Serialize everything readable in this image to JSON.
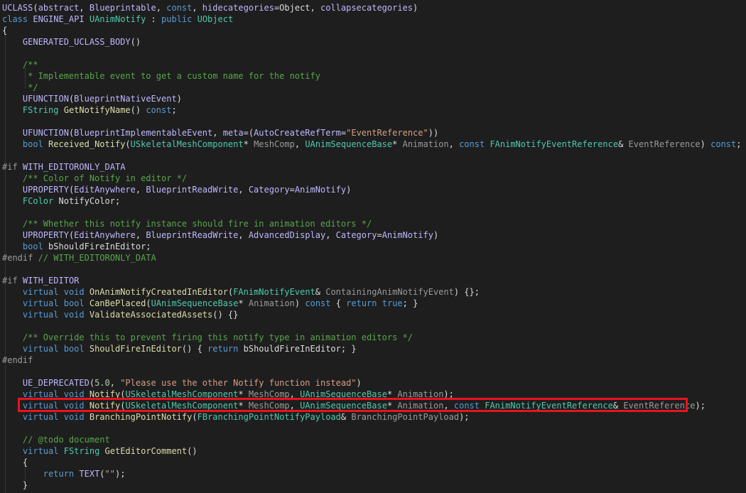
{
  "editor": {
    "language": "cpp",
    "theme_colors": {
      "background": "#1e1e1e",
      "highlight_box": "#e8141c"
    },
    "highlighted_line": 35,
    "lines": [
      [
        [
          "mc",
          "UCLASS"
        ],
        [
          "tx",
          "("
        ],
        [
          "mc",
          "abstract"
        ],
        [
          "tx",
          ", "
        ],
        [
          "mc",
          "Blueprintable"
        ],
        [
          "tx",
          ", "
        ],
        [
          "kw",
          "const"
        ],
        [
          "tx",
          ", "
        ],
        [
          "mc",
          "hidecategories"
        ],
        [
          "tx",
          "=Object, "
        ],
        [
          "mc",
          "collapsecategories"
        ],
        [
          "tx",
          ")"
        ]
      ],
      [
        [
          "kw",
          "class"
        ],
        [
          "tx",
          " "
        ],
        [
          "mc",
          "ENGINE_API"
        ],
        [
          "tx",
          " "
        ],
        [
          "ty",
          "UAnimNotify"
        ],
        [
          "tx",
          " : "
        ],
        [
          "kw",
          "public"
        ],
        [
          "tx",
          " "
        ],
        [
          "ty",
          "UObject"
        ]
      ],
      [
        [
          "tx",
          "{"
        ]
      ],
      [
        [
          "tx",
          "    "
        ],
        [
          "mc",
          "GENERATED_UCLASS_BODY"
        ],
        [
          "tx",
          "()"
        ]
      ],
      [
        [
          "tx",
          ""
        ]
      ],
      [
        [
          "tx",
          "    "
        ],
        [
          "cm",
          "/**"
        ]
      ],
      [
        [
          "tx",
          "    "
        ],
        [
          "cm",
          " * Implementable event to get a custom name for the notify"
        ]
      ],
      [
        [
          "tx",
          "    "
        ],
        [
          "cm",
          " */"
        ]
      ],
      [
        [
          "tx",
          "    "
        ],
        [
          "mc",
          "UFUNCTION"
        ],
        [
          "tx",
          "("
        ],
        [
          "mc",
          "BlueprintNativeEvent"
        ],
        [
          "tx",
          ")"
        ]
      ],
      [
        [
          "tx",
          "    "
        ],
        [
          "ty",
          "FString"
        ],
        [
          "tx",
          " "
        ],
        [
          "fn",
          "GetNotifyName"
        ],
        [
          "tx",
          "() "
        ],
        [
          "kw",
          "const"
        ],
        [
          "tx",
          ";"
        ]
      ],
      [
        [
          "tx",
          ""
        ]
      ],
      [
        [
          "tx",
          "    "
        ],
        [
          "mc",
          "UFUNCTION"
        ],
        [
          "tx",
          "("
        ],
        [
          "mc",
          "BlueprintImplementableEvent"
        ],
        [
          "tx",
          ", "
        ],
        [
          "mc",
          "meta"
        ],
        [
          "tx",
          "=("
        ],
        [
          "mc",
          "AutoCreateRefTerm"
        ],
        [
          "tx",
          "="
        ],
        [
          "st",
          "\"EventReference\""
        ],
        [
          "tx",
          "))"
        ]
      ],
      [
        [
          "tx",
          "    "
        ],
        [
          "kw",
          "bool"
        ],
        [
          "tx",
          " "
        ],
        [
          "fn",
          "Received_Notify"
        ],
        [
          "tx",
          "("
        ],
        [
          "ty",
          "USkeletalMeshComponent"
        ],
        [
          "tx",
          "* "
        ],
        [
          "pa",
          "MeshComp"
        ],
        [
          "tx",
          ", "
        ],
        [
          "ty",
          "UAnimSequenceBase"
        ],
        [
          "tx",
          "* "
        ],
        [
          "pa",
          "Animation"
        ],
        [
          "tx",
          ", "
        ],
        [
          "kw",
          "const"
        ],
        [
          "tx",
          " "
        ],
        [
          "ty",
          "FAnimNotifyEventReference"
        ],
        [
          "tx",
          "& "
        ],
        [
          "pa",
          "EventReference"
        ],
        [
          "tx",
          ") "
        ],
        [
          "kw",
          "const"
        ],
        [
          "tx",
          ";"
        ]
      ],
      [
        [
          "tx",
          ""
        ]
      ],
      [
        [
          "pp",
          "#if"
        ],
        [
          "tx",
          " "
        ],
        [
          "mc",
          "WITH_EDITORONLY_DATA"
        ]
      ],
      [
        [
          "tx",
          "    "
        ],
        [
          "cm",
          "/** Color of Notify in editor */"
        ]
      ],
      [
        [
          "tx",
          "    "
        ],
        [
          "mc",
          "UPROPERTY"
        ],
        [
          "tx",
          "("
        ],
        [
          "mc",
          "EditAnywhere"
        ],
        [
          "tx",
          ", "
        ],
        [
          "mc",
          "BlueprintReadWrite"
        ],
        [
          "tx",
          ", "
        ],
        [
          "mc",
          "Category"
        ],
        [
          "tx",
          "="
        ],
        [
          "mc",
          "AnimNotify"
        ],
        [
          "tx",
          ")"
        ]
      ],
      [
        [
          "tx",
          "    "
        ],
        [
          "ty",
          "FColor"
        ],
        [
          "tx",
          " NotifyColor;"
        ]
      ],
      [
        [
          "tx",
          ""
        ]
      ],
      [
        [
          "tx",
          "    "
        ],
        [
          "cm",
          "/** Whether this notify instance should fire in animation editors */"
        ]
      ],
      [
        [
          "tx",
          "    "
        ],
        [
          "mc",
          "UPROPERTY"
        ],
        [
          "tx",
          "("
        ],
        [
          "mc",
          "EditAnywhere"
        ],
        [
          "tx",
          ", "
        ],
        [
          "mc",
          "BlueprintReadWrite"
        ],
        [
          "tx",
          ", "
        ],
        [
          "mc",
          "AdvancedDisplay"
        ],
        [
          "tx",
          ", "
        ],
        [
          "mc",
          "Category"
        ],
        [
          "tx",
          "="
        ],
        [
          "mc",
          "AnimNotify"
        ],
        [
          "tx",
          ")"
        ]
      ],
      [
        [
          "tx",
          "    "
        ],
        [
          "kw",
          "bool"
        ],
        [
          "tx",
          " bShouldFireInEditor;"
        ]
      ],
      [
        [
          "pp",
          "#endif"
        ],
        [
          "tx",
          " "
        ],
        [
          "cm",
          "// WITH_EDITORONLY_DATA"
        ]
      ],
      [
        [
          "tx",
          ""
        ]
      ],
      [
        [
          "pp",
          "#if"
        ],
        [
          "tx",
          " "
        ],
        [
          "mc",
          "WITH_EDITOR"
        ]
      ],
      [
        [
          "tx",
          "    "
        ],
        [
          "kw",
          "virtual"
        ],
        [
          "tx",
          " "
        ],
        [
          "kw",
          "void"
        ],
        [
          "tx",
          " "
        ],
        [
          "fn",
          "OnAnimNotifyCreatedInEditor"
        ],
        [
          "tx",
          "("
        ],
        [
          "ty",
          "FAnimNotifyEvent"
        ],
        [
          "tx",
          "& "
        ],
        [
          "pa",
          "ContainingAnimNotifyEvent"
        ],
        [
          "tx",
          ") {};"
        ]
      ],
      [
        [
          "tx",
          "    "
        ],
        [
          "kw",
          "virtual"
        ],
        [
          "tx",
          " "
        ],
        [
          "kw",
          "bool"
        ],
        [
          "tx",
          " "
        ],
        [
          "fn",
          "CanBePlaced"
        ],
        [
          "tx",
          "("
        ],
        [
          "ty",
          "UAnimSequenceBase"
        ],
        [
          "tx",
          "* "
        ],
        [
          "pa",
          "Animation"
        ],
        [
          "tx",
          ") "
        ],
        [
          "kw",
          "const"
        ],
        [
          "tx",
          " { "
        ],
        [
          "kw",
          "return"
        ],
        [
          "tx",
          " "
        ],
        [
          "kw",
          "true"
        ],
        [
          "tx",
          "; }"
        ]
      ],
      [
        [
          "tx",
          "    "
        ],
        [
          "kw",
          "virtual"
        ],
        [
          "tx",
          " "
        ],
        [
          "kw",
          "void"
        ],
        [
          "tx",
          " "
        ],
        [
          "fn",
          "ValidateAssociatedAssets"
        ],
        [
          "tx",
          "() {}"
        ]
      ],
      [
        [
          "tx",
          ""
        ]
      ],
      [
        [
          "tx",
          "    "
        ],
        [
          "cm",
          "/** Override this to prevent firing this notify type in animation editors */"
        ]
      ],
      [
        [
          "tx",
          "    "
        ],
        [
          "kw",
          "virtual"
        ],
        [
          "tx",
          " "
        ],
        [
          "kw",
          "bool"
        ],
        [
          "tx",
          " "
        ],
        [
          "fn",
          "ShouldFireInEditor"
        ],
        [
          "tx",
          "() { "
        ],
        [
          "kw",
          "return"
        ],
        [
          "tx",
          " bShouldFireInEditor; }"
        ]
      ],
      [
        [
          "pp",
          "#endif"
        ]
      ],
      [
        [
          "tx",
          ""
        ]
      ],
      [
        [
          "tx",
          "    "
        ],
        [
          "mc",
          "UE_DEPRECATED"
        ],
        [
          "tx",
          "("
        ],
        [
          "nu",
          "5.0"
        ],
        [
          "tx",
          ", "
        ],
        [
          "st",
          "\"Please use the other Notify function instead\""
        ],
        [
          "tx",
          ")"
        ]
      ],
      [
        [
          "tx",
          "    "
        ],
        [
          "kw",
          "virtual"
        ],
        [
          "tx",
          " "
        ],
        [
          "kw",
          "void"
        ],
        [
          "tx",
          " "
        ],
        [
          "fn",
          "Notify"
        ],
        [
          "tx",
          "("
        ],
        [
          "ty",
          "USkeletalMeshComponent"
        ],
        [
          "tx",
          "* "
        ],
        [
          "pa",
          "MeshComp"
        ],
        [
          "tx",
          ", "
        ],
        [
          "ty",
          "UAnimSequenceBase"
        ],
        [
          "tx",
          "* "
        ],
        [
          "pa",
          "Animation"
        ],
        [
          "tx",
          ");"
        ]
      ],
      [
        [
          "tx",
          "    "
        ],
        [
          "kw",
          "virtual"
        ],
        [
          "tx",
          " "
        ],
        [
          "kw",
          "void"
        ],
        [
          "tx",
          " "
        ],
        [
          "fn",
          "Notify"
        ],
        [
          "tx",
          "("
        ],
        [
          "ty",
          "USkeletalMeshComponent"
        ],
        [
          "tx",
          "* "
        ],
        [
          "pa",
          "MeshComp"
        ],
        [
          "tx",
          ", "
        ],
        [
          "ty",
          "UAnimSequenceBase"
        ],
        [
          "tx",
          "* "
        ],
        [
          "pa",
          "Animation"
        ],
        [
          "tx",
          ", "
        ],
        [
          "kw",
          "const"
        ],
        [
          "tx",
          " "
        ],
        [
          "ty",
          "FAnimNotifyEventReference"
        ],
        [
          "tx",
          "& "
        ],
        [
          "pa",
          "EventReference"
        ],
        [
          "tx",
          ");"
        ]
      ],
      [
        [
          "tx",
          "    "
        ],
        [
          "kw",
          "virtual"
        ],
        [
          "tx",
          " "
        ],
        [
          "kw",
          "void"
        ],
        [
          "tx",
          " "
        ],
        [
          "fn",
          "BranchingPointNotify"
        ],
        [
          "tx",
          "("
        ],
        [
          "ty",
          "FBranchingPointNotifyPayload"
        ],
        [
          "tx",
          "& "
        ],
        [
          "pa",
          "BranchingPointPayload"
        ],
        [
          "tx",
          ");"
        ]
      ],
      [
        [
          "tx",
          ""
        ]
      ],
      [
        [
          "tx",
          "    "
        ],
        [
          "cm",
          "// @todo document"
        ]
      ],
      [
        [
          "tx",
          "    "
        ],
        [
          "kw",
          "virtual"
        ],
        [
          "tx",
          " "
        ],
        [
          "ty",
          "FString"
        ],
        [
          "tx",
          " "
        ],
        [
          "fn",
          "GetEditorComment"
        ],
        [
          "tx",
          "()"
        ]
      ],
      [
        [
          "tx",
          "    {"
        ]
      ],
      [
        [
          "tx",
          "        "
        ],
        [
          "kw",
          "return"
        ],
        [
          "tx",
          " "
        ],
        [
          "mc",
          "TEXT"
        ],
        [
          "tx",
          "("
        ],
        [
          "st",
          "\"\""
        ],
        [
          "tx",
          ");"
        ]
      ],
      [
        [
          "tx",
          "    }"
        ]
      ]
    ]
  }
}
